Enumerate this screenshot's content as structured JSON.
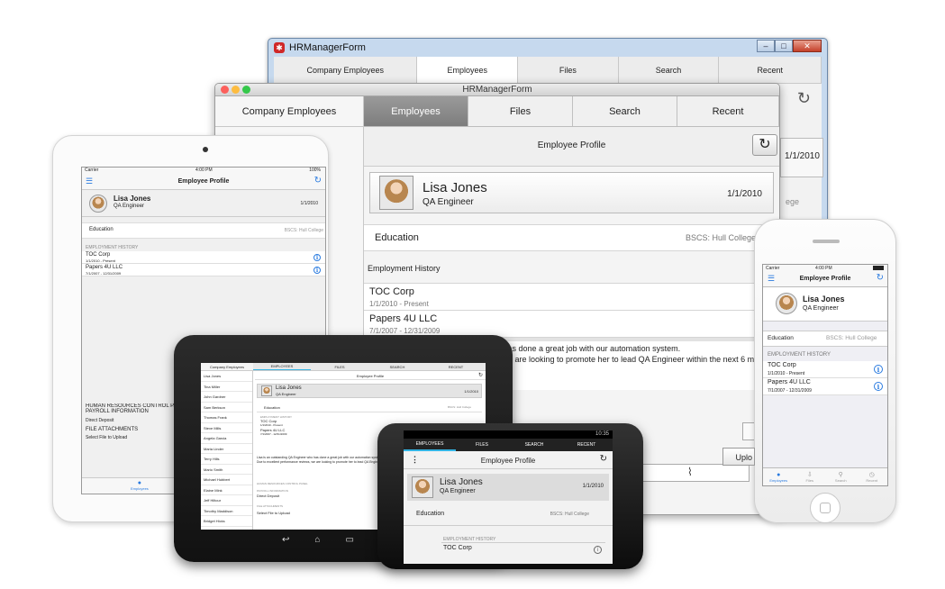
{
  "app": {
    "win_title": "HRManagerForm",
    "tabs": [
      "Company Employees",
      "Employees",
      "Files",
      "Search",
      "Recent"
    ],
    "android_tabs": [
      "EMPLOYEES",
      "FILES",
      "SEARCH",
      "RECENT"
    ],
    "profile_header": "Employee Profile",
    "employee": {
      "name": "Lisa Jones",
      "title": "QA Engineer",
      "date": "1/1/2010"
    },
    "education_label": "Education",
    "education_value": "BSCS: Hull College",
    "history_label": "Employment History",
    "history_label_caps": "EMPLOYMENT HISTORY",
    "history": [
      {
        "company": "TOC Corp",
        "range": "1/1/2010 - Present"
      },
      {
        "company": "Papers 4U LLC",
        "range": "7/1/2007 - 12/31/2009"
      }
    ],
    "bio_lines": [
      "Lisa is an outstanding QA Engineer who has done a great job with our automation system.",
      "Due to excellent performance reviews, we are looking to promote her to lead QA Engineer within the next 6 months."
    ],
    "bio_frag1": "ho has done a great job with our automation system.",
    "bio_frag2": "e are looking to promote her to lead QA Engineer within the next 6 mont",
    "hr_panel_label": "HUMAN RESOURCES CONTROL PA",
    "hr_panel_label_small": "HUMAN RESOURCES CONTROL PANEL",
    "payroll_label": "PAYROLL INFORMATION",
    "direct_deposit": "Direct Deposit",
    "file_attach_label": "FILE ATTACHMENTS",
    "select_file": "Select File to Upload",
    "upload_btn": "Uplo",
    "employee_list": [
      "Lisa Jones",
      "Tina Miller",
      "John Gardner",
      "Sam Berkson",
      "Thomas Frank",
      "Steve Mills",
      "Angela Garcia",
      "Maria Linder",
      "Terry Hills",
      "Mario Smith",
      "Michael Hubbert",
      "Elaine Mink",
      "Jeff Hiltour",
      "Timothy Maddison",
      "Bridget Hicks"
    ],
    "status": {
      "carrier": "Carrier",
      "time_ipad": "4:00 PM",
      "time_iphone": "4:00 PM",
      "battery": "100%",
      "android_time": "10:35"
    },
    "ios_tabbar": [
      "Employees",
      "Files",
      "Search",
      "Recent"
    ],
    "ios_tabbar_ipad": "Employees"
  },
  "colors": {
    "accent": "#2a7be0",
    "android_accent": "#33b5e5"
  }
}
